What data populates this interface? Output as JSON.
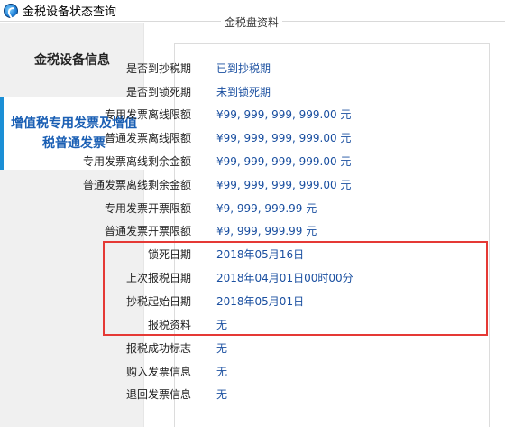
{
  "window": {
    "title": "金税设备状态查询"
  },
  "sidebar": {
    "items": [
      {
        "label": "金税设备信息"
      },
      {
        "label": "增值税专用发票及增值税普通发票"
      }
    ]
  },
  "group": {
    "legend": "金税盘资料",
    "rows": [
      {
        "label": "是否到抄税期",
        "value": "已到抄税期"
      },
      {
        "label": "是否到锁死期",
        "value": "未到锁死期"
      },
      {
        "label": "专用发票离线限额",
        "value": "¥99, 999, 999, 999.00 元"
      },
      {
        "label": "普通发票离线限额",
        "value": "¥99, 999, 999, 999.00 元"
      },
      {
        "label": "专用发票离线剩余金额",
        "value": "¥99, 999, 999, 999.00 元"
      },
      {
        "label": "普通发票离线剩余金额",
        "value": "¥99, 999, 999, 999.00 元"
      },
      {
        "label": "专用发票开票限额",
        "value": "¥9, 999, 999.99 元"
      },
      {
        "label": "普通发票开票限额",
        "value": "¥9, 999, 999.99 元"
      },
      {
        "label": "锁死日期",
        "value": "2018年05月16日"
      },
      {
        "label": "上次报税日期",
        "value": "2018年04月01日00时00分"
      },
      {
        "label": "抄税起始日期",
        "value": "2018年05月01日"
      },
      {
        "label": "报税资料",
        "value": "无"
      },
      {
        "label": "报税成功标志",
        "value": "无"
      },
      {
        "label": "购入发票信息",
        "value": "无"
      },
      {
        "label": "退回发票信息",
        "value": "无"
      }
    ]
  },
  "colors": {
    "highlight": "#e53935",
    "value_text": "#1a4fa0",
    "active_tab": "#1b8fd6"
  }
}
